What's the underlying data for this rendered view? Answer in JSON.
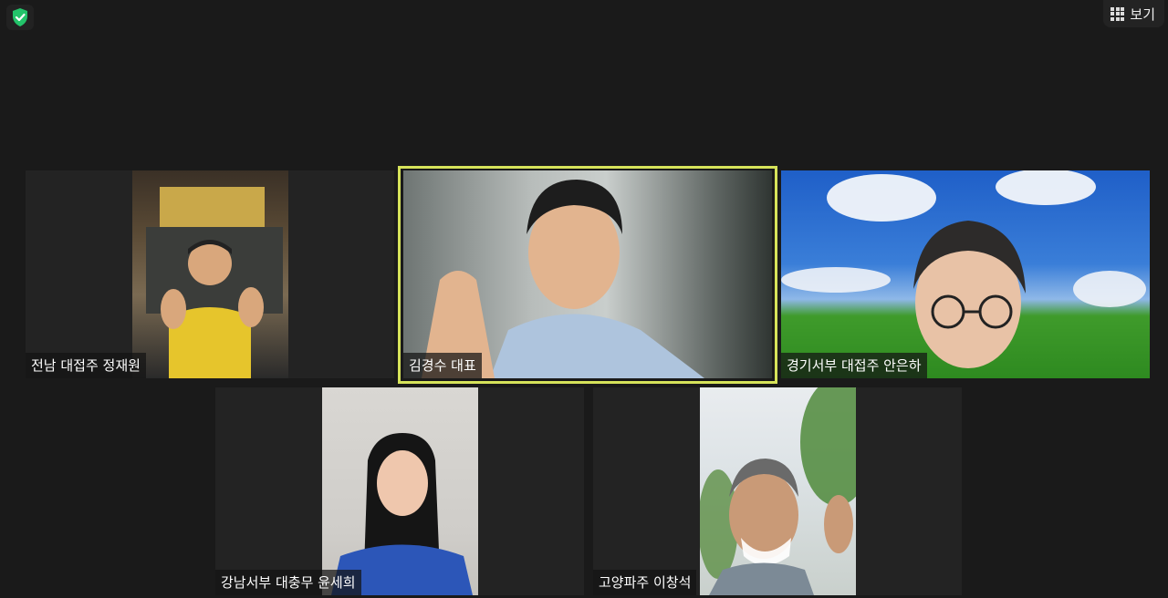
{
  "toolbar": {
    "view_label": "보기",
    "security_icon": "shield-check-icon",
    "view_icon": "grid-icon"
  },
  "colors": {
    "active_speaker_border": "#d6e35a",
    "security_green": "#23c36a"
  },
  "participants": [
    {
      "name": "전남 대접주 정재원",
      "active": false
    },
    {
      "name": "김경수 대표",
      "active": true
    },
    {
      "name": "경기서부 대접주 안은하",
      "active": false
    },
    {
      "name": "강남서부 대충무 윤세희",
      "active": false
    },
    {
      "name": "고양파주 이창석",
      "active": false
    }
  ]
}
